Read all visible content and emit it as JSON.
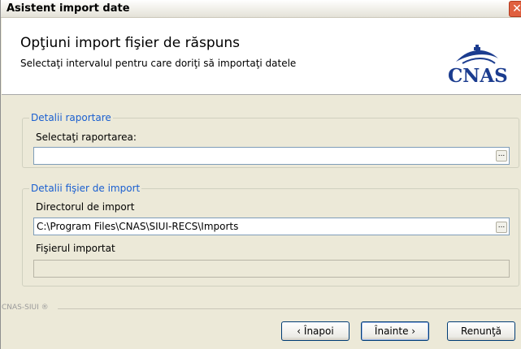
{
  "window": {
    "title": "Asistent import date",
    "close_glyph": "✕"
  },
  "header": {
    "title": "Opţiuni import fişier de răspuns",
    "subtitle": "Selectaţi intervalul pentru care doriţi să importaţi datele",
    "logo_text": "CNAS"
  },
  "reporting_group": {
    "legend": "Detalii raportare",
    "label": "Selectaţi raportarea:",
    "value": "",
    "browse_label": "..."
  },
  "import_group": {
    "legend": "Detalii fişier de import",
    "directory_label": "Directorul de import",
    "directory_value": "C:\\Program Files\\CNAS\\SIUI-RECS\\Imports",
    "browse_label": "...",
    "file_label": "Fişierul importat",
    "file_value": ""
  },
  "footer": {
    "brand": "CNAS-SIUI ®",
    "back_label": "‹ Înapoi",
    "next_label": "Înainte ›",
    "cancel_label": "Renunţă"
  },
  "colors": {
    "legend": "#1a5fd0",
    "logo": "#1b3c8f",
    "close": "#e0603f"
  },
  "icons": {
    "logo": "cnas-logo-icon",
    "close": "close-icon"
  }
}
